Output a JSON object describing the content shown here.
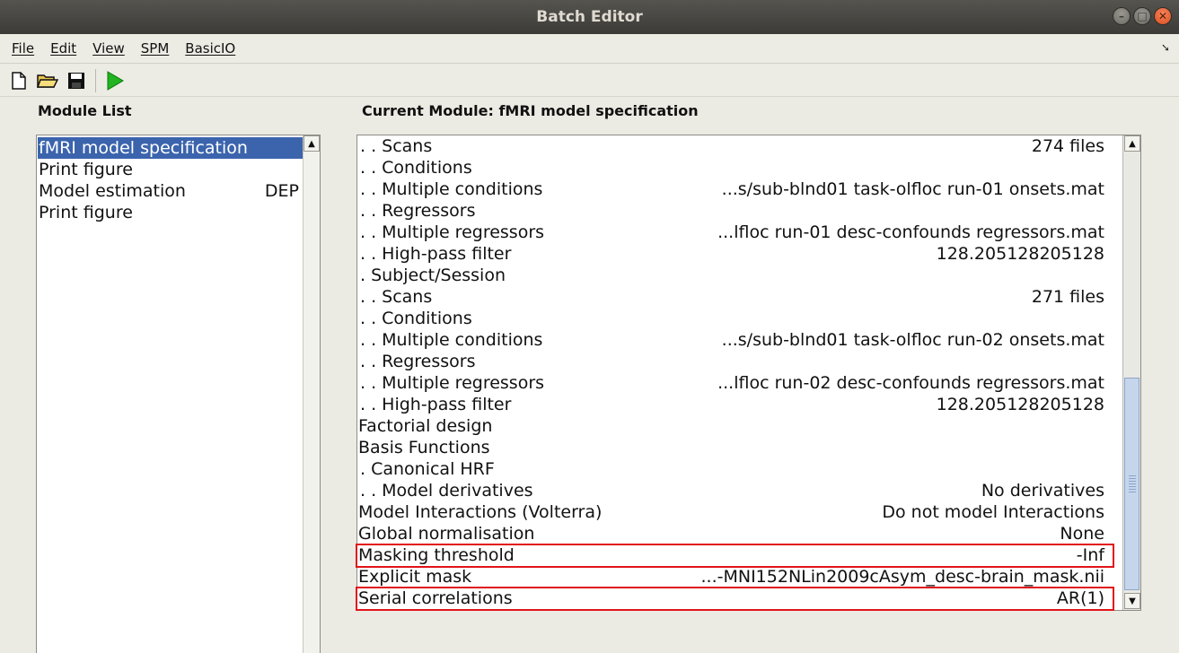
{
  "window": {
    "title": "Batch Editor"
  },
  "menubar": {
    "items": [
      "File",
      "Edit",
      "View",
      "SPM",
      "BasicIO"
    ]
  },
  "labels": {
    "module_list": "Module List",
    "current_module": "Current Module: fMRI model specification"
  },
  "module_list": {
    "items": [
      {
        "label": "fMRI model specification",
        "dep": ""
      },
      {
        "label": "Print figure",
        "dep": ""
      },
      {
        "label": "Model estimation",
        "dep": "DEP"
      },
      {
        "label": "Print figure",
        "dep": ""
      }
    ],
    "selected_index": 0
  },
  "module_detail": {
    "rows": [
      {
        "label": ". . Scans",
        "value": "274 files"
      },
      {
        "label": ". . Conditions",
        "value": ""
      },
      {
        "label": ". . Multiple conditions",
        "value": "...s/sub-blnd01 task-olfloc run-01 onsets.mat"
      },
      {
        "label": ". . Regressors",
        "value": ""
      },
      {
        "label": ". . Multiple regressors",
        "value": "...lfloc run-01 desc-confounds regressors.mat"
      },
      {
        "label": ". . High-pass filter",
        "value": "128.205128205128"
      },
      {
        "label": ". Subject/Session",
        "value": ""
      },
      {
        "label": ". . Scans",
        "value": "271 files"
      },
      {
        "label": ". . Conditions",
        "value": ""
      },
      {
        "label": ". . Multiple conditions",
        "value": "...s/sub-blnd01 task-olfloc run-02 onsets.mat"
      },
      {
        "label": ". . Regressors",
        "value": ""
      },
      {
        "label": ". . Multiple regressors",
        "value": "...lfloc run-02 desc-confounds regressors.mat"
      },
      {
        "label": ". . High-pass filter",
        "value": "128.205128205128"
      },
      {
        "label": "Factorial design",
        "value": ""
      },
      {
        "label": "Basis Functions",
        "value": ""
      },
      {
        "label": ". Canonical HRF",
        "value": ""
      },
      {
        "label": ". . Model derivatives",
        "value": "No derivatives"
      },
      {
        "label": "Model Interactions (Volterra)",
        "value": "Do not model Interactions"
      },
      {
        "label": "Global normalisation",
        "value": "None"
      },
      {
        "label": "Masking threshold",
        "value": "-Inf"
      },
      {
        "label": "Explicit mask",
        "value": "...-MNI152NLin2009cAsym_desc-brain_mask.nii"
      },
      {
        "label": "Serial correlations",
        "value": "AR(1)"
      }
    ],
    "highlighted_rows": [
      19,
      21
    ],
    "highlight_color": "#e0141a"
  },
  "colors": {
    "selection": "#3b64ad",
    "run_icon": "#22b422"
  },
  "icons": [
    "new-file-icon",
    "open-folder-icon",
    "save-icon",
    "run-icon"
  ]
}
